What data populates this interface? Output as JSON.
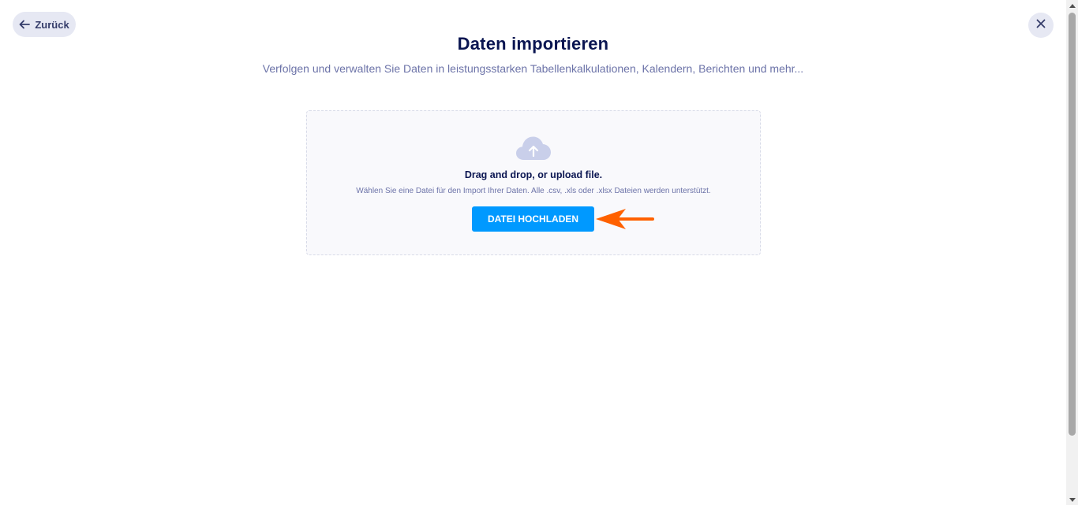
{
  "nav": {
    "back_label": "Zurück",
    "close_icon": "close-icon"
  },
  "header": {
    "title": "Daten importieren",
    "subtitle": "Verfolgen und verwalten Sie Daten in leistungsstarken Tabellenkalkulationen, Kalendern, Berichten und mehr..."
  },
  "dropzone": {
    "icon": "cloud-upload-icon",
    "title": "Drag and drop, or upload file.",
    "hint": "Wählen Sie eine Datei für den Import Ihrer Daten. Alle .csv, .xls oder .xlsx Dateien werden unterstützt.",
    "button_label": "DATEI HOCHLADEN"
  },
  "colors": {
    "accent": "#0099ff",
    "title": "#0a1551",
    "muted": "#6c73a8",
    "annotation_arrow": "#ff6100"
  }
}
